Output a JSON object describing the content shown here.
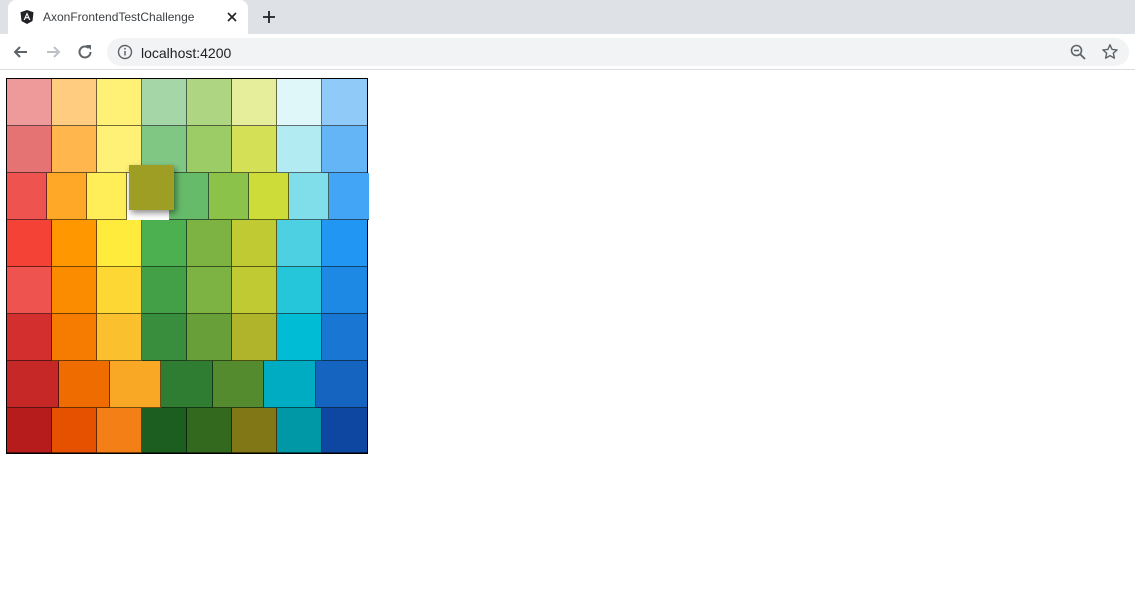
{
  "browser": {
    "tab_title": "AxonFrontendTestChallenge",
    "url": "localhost:4200",
    "icons": [
      "angular-logo-icon",
      "close-icon",
      "plus-icon",
      "back-arrow-icon",
      "forward-arrow-icon",
      "reload-icon",
      "info-icon",
      "zoom-out-icon",
      "star-icon"
    ]
  },
  "board": {
    "rows": [
      [
        "#ef9a9a",
        "#ffcc80",
        "#fff176",
        "#a5d6a7",
        "#aed581",
        "#e6ee9c",
        "#e0f7fa",
        "#90caf9"
      ],
      [
        "#e57373",
        "#ffb74d",
        "#fff176",
        "#81c784",
        "#9ccc65",
        "#d4e157",
        "#b2ebf2",
        "#64b5f6"
      ],
      [
        "#ef5350",
        "#ffa726",
        "#ffee58",
        "gap",
        "#66bb6a",
        "#8bc34a",
        "#cddc39",
        "#80deea",
        "#42a5f5"
      ],
      [
        "#f44336",
        "#ff9800",
        "#ffeb3b",
        "#4caf50",
        "#7cb342",
        "#c0ca33",
        "#4dd0e1",
        "#2196f3"
      ],
      [
        "#ef5350",
        "#fb8c00",
        "#fdd835",
        "#43a047",
        "#7cb342",
        "#c0ca33",
        "#26c6da",
        "#1e88e5"
      ],
      [
        "#d32f2f",
        "#f57c00",
        "#fbc02d",
        "#388e3c",
        "#689f38",
        "#afb42b",
        "#00bcd4",
        "#1976d2"
      ],
      [
        "#c62828",
        "#ef6c00",
        "#f9a825",
        "#2e7d32",
        "#558b2f",
        "#00acc1",
        "#1565c0"
      ],
      [
        "#b71c1c",
        "#e65100",
        "#f57f17",
        "#1b5e20",
        "#33691e",
        "#827717",
        "#0097a7",
        "#0d47a1"
      ]
    ],
    "dragged_color": "#9e9d24"
  }
}
